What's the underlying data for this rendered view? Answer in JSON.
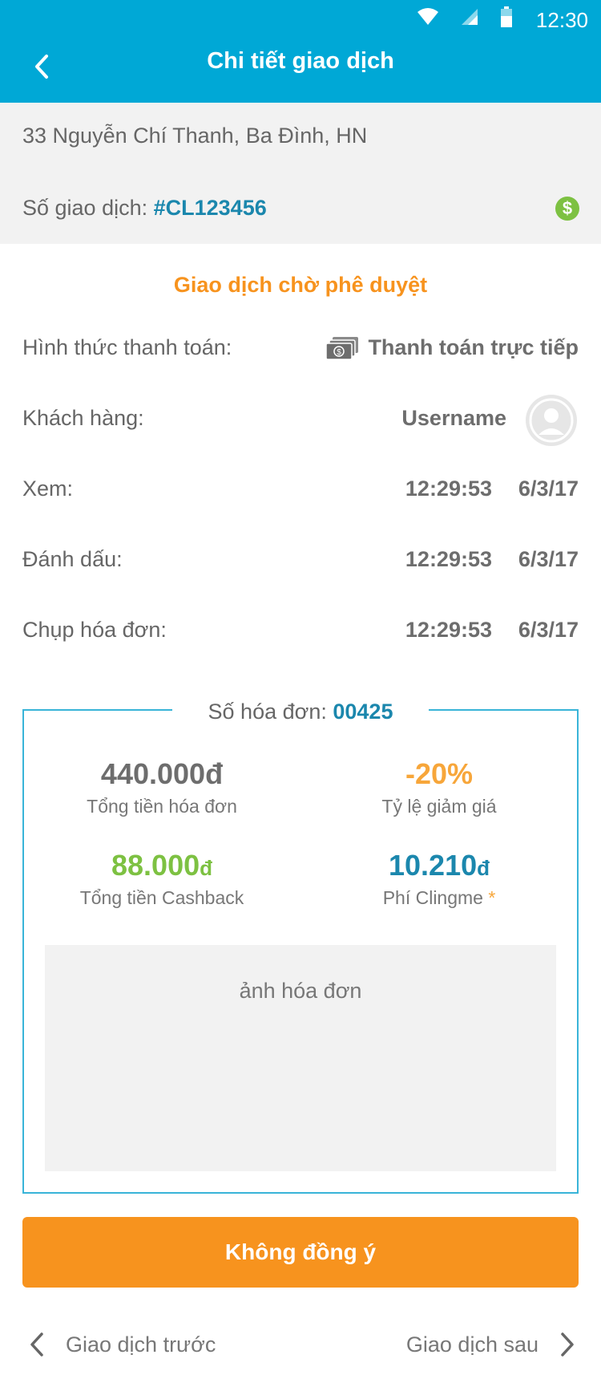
{
  "status_bar": {
    "time": "12:30",
    "icons": [
      "wifi-icon",
      "signal-icon",
      "battery-icon"
    ]
  },
  "header": {
    "title": "Chi tiết giao dịch"
  },
  "transaction": {
    "address": "33 Nguyễn Chí Thanh, Ba Đình, HN",
    "number_label": "Số giao dịch:",
    "number_value": "#CL123456"
  },
  "status_text": "Giao dịch chờ phê duyệt",
  "details": {
    "payment_label": "Hình thức thanh toán:",
    "payment_value": "Thanh toán trực tiếp",
    "customer_label": "Khách hàng:",
    "customer_value": "Username",
    "view_label": "Xem:",
    "view_time": "12:29:53",
    "view_date": "6/3/17",
    "mark_label": "Đánh dấu:",
    "mark_time": "12:29:53",
    "mark_date": "6/3/17",
    "photo_label": "Chụp hóa đơn:",
    "photo_time": "12:29:53",
    "photo_date": "6/3/17"
  },
  "invoice": {
    "number_label": "Số hóa đơn:",
    "number_value": "00425",
    "total_value": "440.000",
    "total_unit": "đ",
    "total_label": "Tổng tiền hóa đơn",
    "discount_value": "-20%",
    "discount_label": "Tỷ lệ giảm giá",
    "cashback_value": "88.000",
    "cashback_unit": "đ",
    "cashback_label": "Tổng tiền Cashback",
    "fee_value": "10.210",
    "fee_unit": "đ",
    "fee_label": "Phí Clingme",
    "fee_asterisk": "*",
    "photo_placeholder": "ảnh hóa đơn"
  },
  "actions": {
    "reject_button": "Không đồng ý",
    "prev_label": "Giao dịch trước",
    "next_label": "Giao dịch sau"
  },
  "colors": {
    "header": "#00a8d6",
    "accent_orange": "#f7931e",
    "accent_blue": "#1b87ad",
    "accent_green": "#7dc142",
    "border_blue": "#39b4d8"
  }
}
